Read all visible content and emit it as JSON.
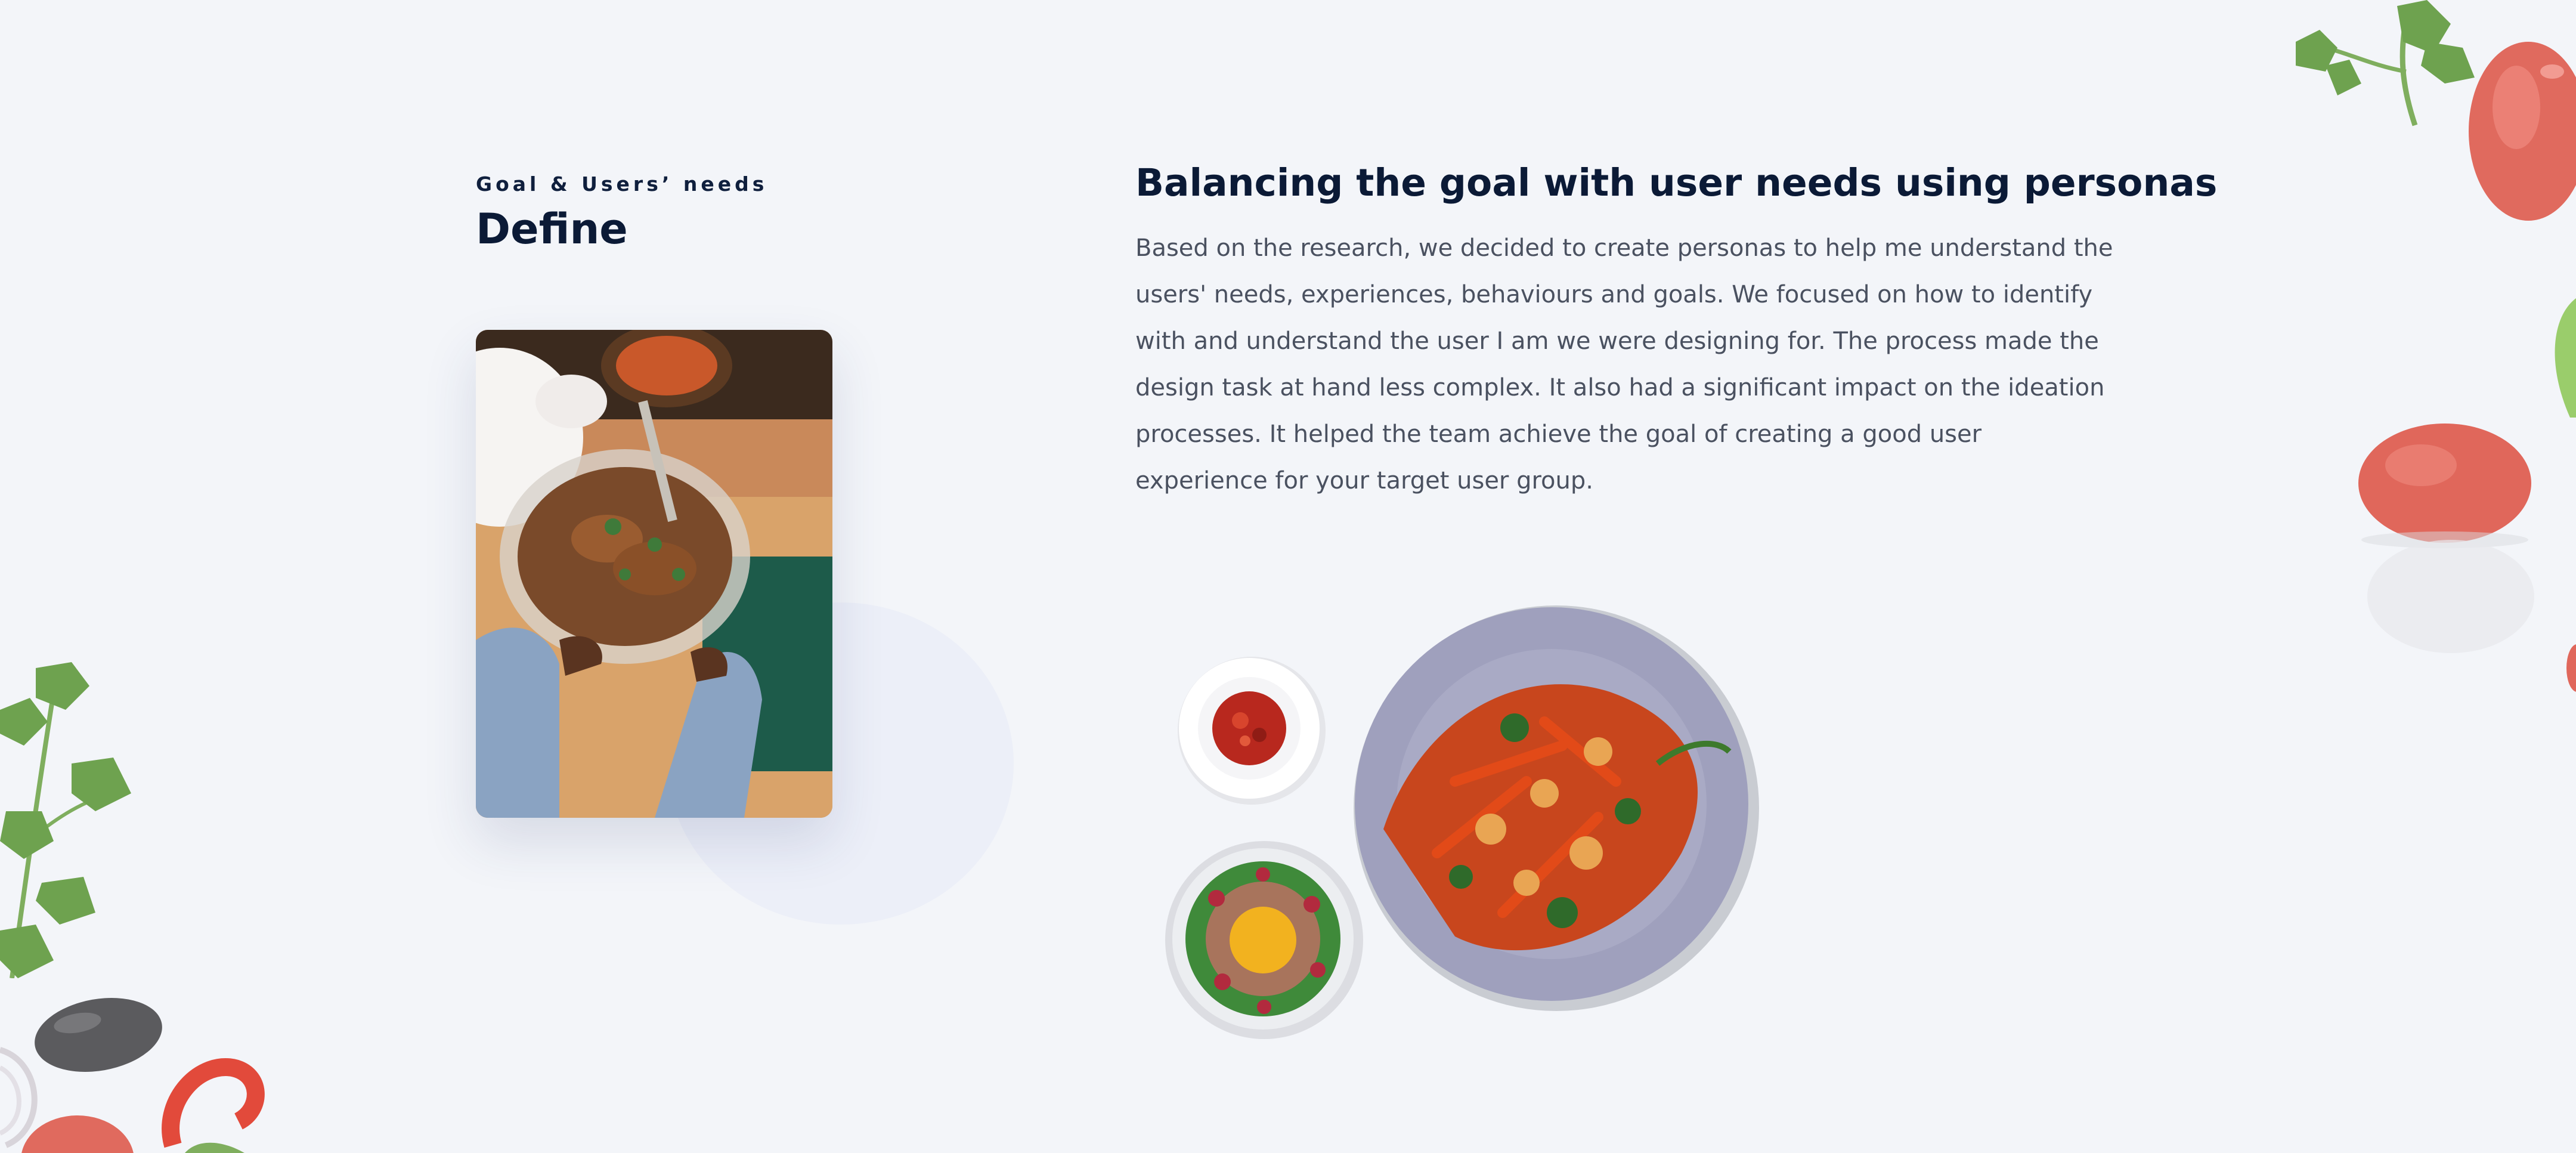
{
  "define_section": {
    "eyebrow": "Goal & Users’ needs",
    "title": "Define"
  },
  "content": {
    "headline": "Balancing the goal with user needs using personas",
    "paragraph": "Based on the research, we decided to create personas to help me understand the users' needs, experiences, behaviours and goals. We focused on how to identify with and understand the user I am we were designing for. The process made the design task at hand less complex. It also had a significant impact on the ideation processes. It helped the team achieve the goal of creating a good user experience for your target user group."
  },
  "colors": {
    "background": "#f3f5f9",
    "heading": "#0b1a36",
    "body": "#4a5160"
  }
}
